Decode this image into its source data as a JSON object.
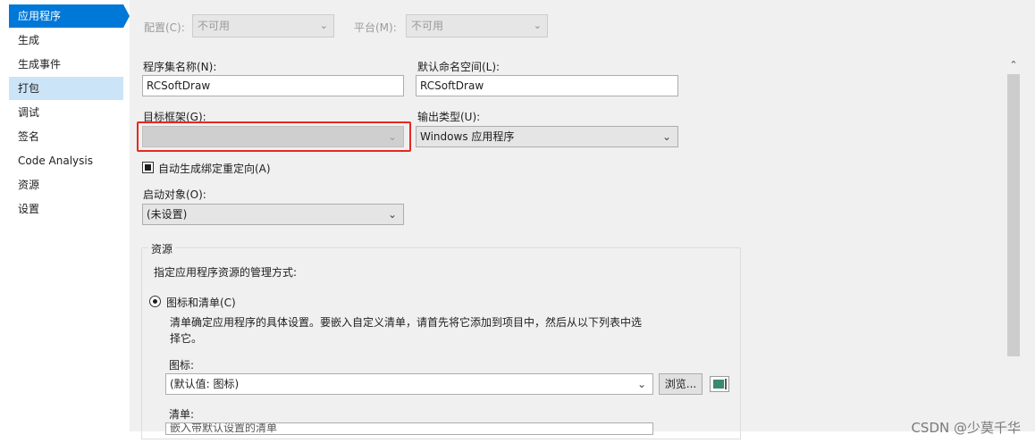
{
  "sidebar": {
    "items": [
      {
        "label": "应用程序"
      },
      {
        "label": "生成"
      },
      {
        "label": "生成事件"
      },
      {
        "label": "打包"
      },
      {
        "label": "调试"
      },
      {
        "label": "签名"
      },
      {
        "label": "Code Analysis"
      },
      {
        "label": "资源"
      },
      {
        "label": "设置"
      }
    ],
    "active_index": 0,
    "hover_index": 3
  },
  "toolbar": {
    "config_label": "配置(C):",
    "config_value": "不可用",
    "platform_label": "平台(M):",
    "platform_value": "不可用"
  },
  "form": {
    "assembly_name_label": "程序集名称(N):",
    "assembly_name_value": "RCSoftDraw",
    "default_namespace_label": "默认命名空间(L):",
    "default_namespace_value": "RCSoftDraw",
    "target_framework_label": "目标框架(G):",
    "target_framework_value": "",
    "output_type_label": "输出类型(U):",
    "output_type_value": "Windows 应用程序",
    "auto_binding_label": "自动生成绑定重定向(A)",
    "auto_binding_checked": true,
    "startup_object_label": "启动对象(O):",
    "startup_object_value": "(未设置)"
  },
  "resources": {
    "group_title": "资源",
    "description": "指定应用程序资源的管理方式:",
    "icon_manifest_label": "图标和清单(C)",
    "icon_manifest_selected": true,
    "help_line1": "清单确定应用程序的具体设置。要嵌入自定义清单，请首先将它添加到项目中，然后从以下列表中选",
    "help_line2": "择它。",
    "icon_label": "图标:",
    "icon_value": "(默认值: 图标)",
    "browse_label": "浏览...",
    "manifest_label": "清单:",
    "manifest_value": "嵌入带默认设置的清单"
  },
  "watermark": "CSDN @少莫千华",
  "colors": {
    "accent": "#0078d7",
    "hover": "#cce4f7",
    "highlight": "#e8281e",
    "panel": "#f0f0f0"
  }
}
